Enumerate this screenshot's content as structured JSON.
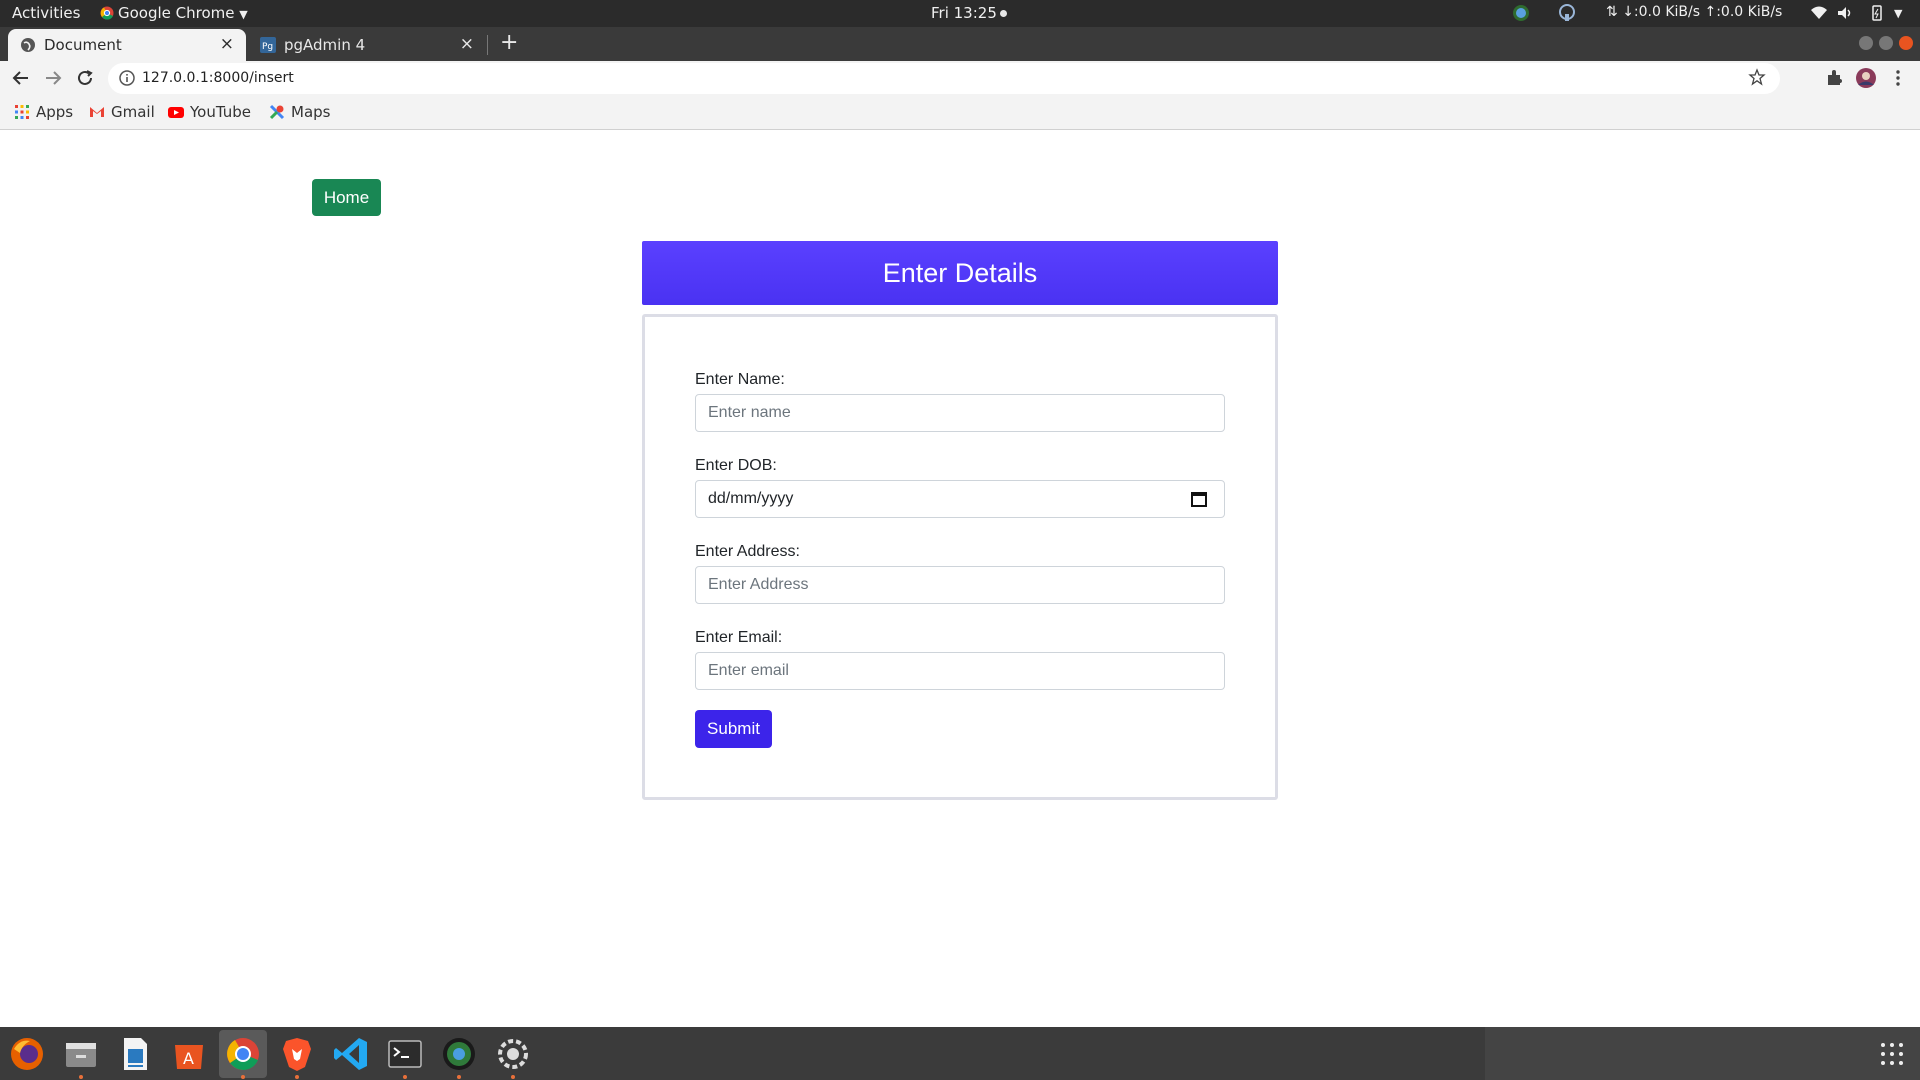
{
  "system_bar": {
    "activities": "Activities",
    "app_menu": "Google Chrome",
    "clock": "Fri 13:25",
    "network_speed": "↓:0.0 KiB/s ↑:0.0 KiB/s"
  },
  "browser": {
    "tabs": [
      {
        "title": "Document",
        "active": true
      },
      {
        "title": "pgAdmin 4",
        "active": false
      }
    ],
    "url": "127.0.0.1:8000/insert",
    "bookmarks": [
      {
        "label": "Apps",
        "icon": "apps-grid-icon"
      },
      {
        "label": "Gmail",
        "icon": "gmail-icon"
      },
      {
        "label": "YouTube",
        "icon": "youtube-icon"
      },
      {
        "label": "Maps",
        "icon": "maps-icon"
      }
    ]
  },
  "page": {
    "home_button": "Home",
    "heading": "Enter Details",
    "form": {
      "name_label": "Enter Name:",
      "name_placeholder": "Enter name",
      "dob_label": "Enter DOB:",
      "dob_value": "dd/mm/yyyy",
      "address_label": "Enter Address:",
      "address_placeholder": "Enter Address",
      "email_label": "Enter Email:",
      "email_placeholder": "Enter email",
      "submit": "Submit"
    }
  },
  "colors": {
    "home_button": "#198754",
    "header": "#4f36f5",
    "submit_button": "#3c24ea"
  },
  "dock": [
    "firefox-icon",
    "files-icon",
    "writer-icon",
    "software-center-icon",
    "chrome-icon",
    "brave-icon",
    "vscode-icon",
    "terminal-icon",
    "globe-app-icon",
    "settings-app-icon"
  ]
}
